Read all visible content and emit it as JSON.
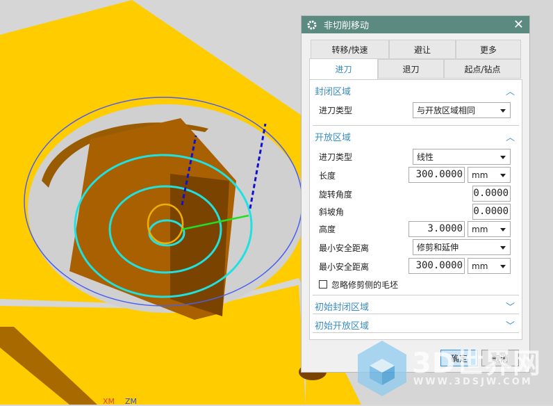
{
  "viewport": {
    "axis_labels": [
      "XM",
      "ZM"
    ]
  },
  "dialog": {
    "title": "非切削移动",
    "icons": {
      "title": "gear-icon",
      "close": "close-icon"
    },
    "tabs_row1": [
      "转移/快速",
      "避让",
      "更多"
    ],
    "tabs_row2": [
      "进刀",
      "退刀",
      "起点/钻点"
    ],
    "active_tab": "进刀",
    "closed_area": {
      "header": "封闭区域",
      "entry_type_label": "进刀类型",
      "entry_type_value": "与开放区域相同"
    },
    "open_area": {
      "header": "开放区域",
      "entry_type_label": "进刀类型",
      "entry_type_value": "线性",
      "length_label": "长度",
      "length_value": "300.0000",
      "length_unit": "mm",
      "rotation_label": "旋转角度",
      "rotation_value": "0.0000",
      "ramp_label": "斜坡角",
      "ramp_value": "0.0000",
      "height_label": "高度",
      "height_value": "3.0000",
      "height_unit": "mm",
      "min_clear_label": "最小安全距离",
      "min_clear_mode": "修剪和延伸",
      "min_clear_label2": "最小安全距离",
      "min_clear_value": "300.0000",
      "min_clear_unit": "mm",
      "ignore_blank_label": "忽略修剪侧的毛坯",
      "ignore_blank_checked": false
    },
    "initial_closed": "初始封闭区域",
    "initial_open": "初始开放区域",
    "ok": "确定",
    "cancel": "取消"
  },
  "watermark": {
    "brand": "3D世界网",
    "url": "WWW.3DSJW.COM"
  }
}
